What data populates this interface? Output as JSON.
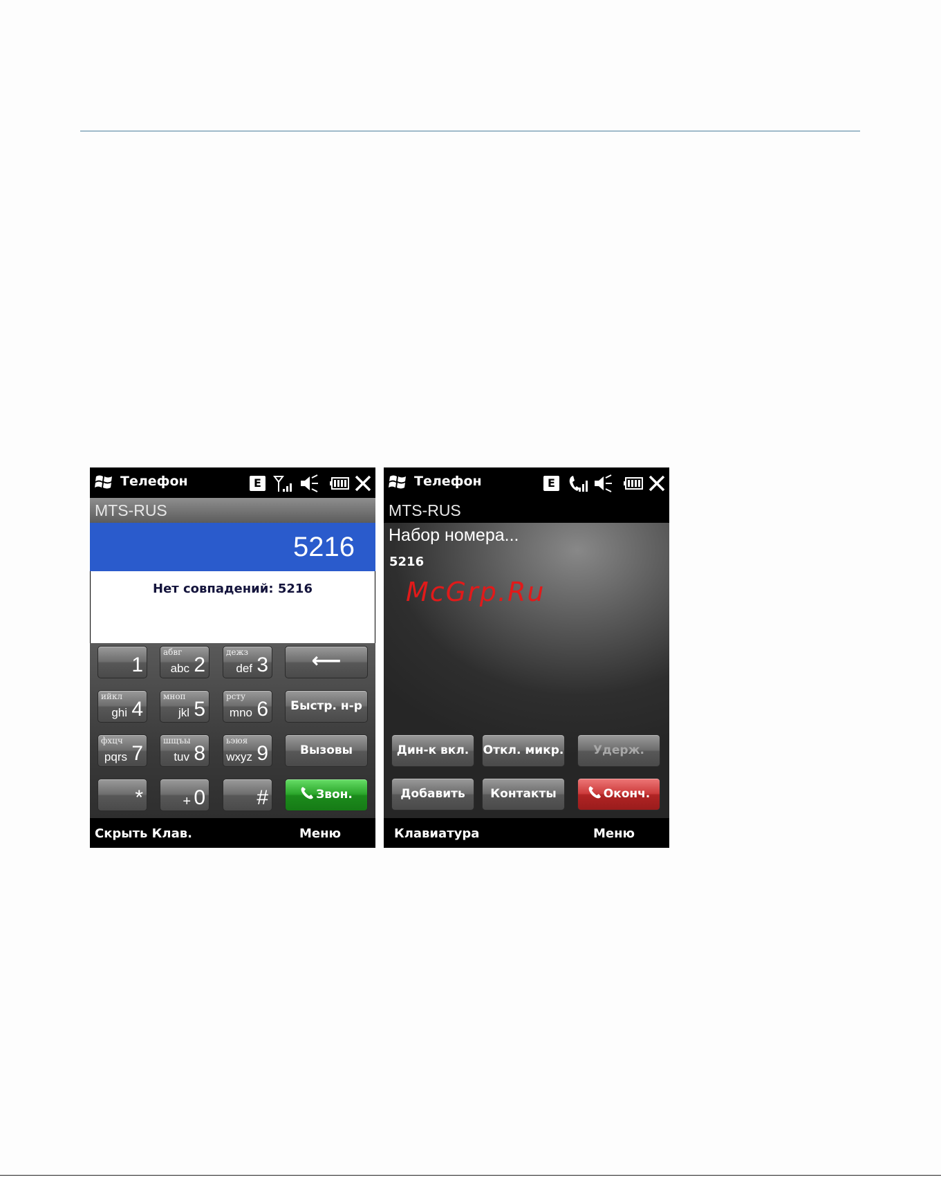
{
  "left_phone": {
    "status": {
      "app_title": "Телефон",
      "network_badge": "E"
    },
    "carrier": "MTS-RUS",
    "dialed_number": "5216",
    "match_message": "Нет совпадений: 5216",
    "keypad": {
      "key1": {
        "digit": "1"
      },
      "key2": {
        "cyr": "абвг",
        "lat": "abc",
        "digit": "2"
      },
      "key3": {
        "cyr": "дежз",
        "lat": "def",
        "digit": "3"
      },
      "key4": {
        "cyr": "ийкл",
        "lat": "ghi",
        "digit": "4"
      },
      "key5": {
        "cyr": "мноп",
        "lat": "jkl",
        "digit": "5"
      },
      "key6": {
        "cyr": "рсту",
        "lat": "mno",
        "digit": "6"
      },
      "key7": {
        "cyr": "фхцч",
        "lat": "pqrs",
        "digit": "7"
      },
      "key8": {
        "cyr": "шщъы",
        "lat": "tuv",
        "digit": "8"
      },
      "key9": {
        "cyr": "ьэюя",
        "lat": "wxyz",
        "digit": "9"
      },
      "star": "*",
      "zero": {
        "lat": "+",
        "digit": "0"
      },
      "hash": "#",
      "backspace": "⟵",
      "speed_dial": "Быстр. н-р",
      "calls": "Вызовы",
      "talk": "Звон."
    },
    "softkeys": {
      "left": "Скрыть Клав.",
      "right": "Меню"
    }
  },
  "right_phone": {
    "status": {
      "app_title": "Телефон",
      "network_badge": "E"
    },
    "carrier": "MTS-RUS",
    "call_state": "Набор номера...",
    "call_number": "5216",
    "watermark": "McGrp.Ru",
    "buttons": {
      "speaker": "Дин-к вкл.",
      "mute": "Откл. микр.",
      "hold": "Удерж.",
      "add": "Добавить",
      "contacts": "Контакты",
      "end": "Оконч."
    },
    "softkeys": {
      "left": "Клавиатура",
      "right": "Меню"
    }
  },
  "colors": {
    "dial_display_bg": "#2a5bcc",
    "talk_green": "#2aa52a",
    "end_red": "#cc3b3b",
    "watermark_red": "#e11a1a"
  }
}
